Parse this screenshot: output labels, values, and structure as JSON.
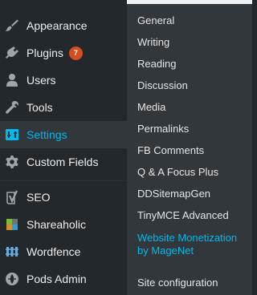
{
  "menu": {
    "items": [
      {
        "label": "Appearance",
        "icon": "paintbrush-icon"
      },
      {
        "label": "Plugins",
        "icon": "plugin-icon",
        "badge": "7"
      },
      {
        "label": "Users",
        "icon": "users-icon"
      },
      {
        "label": "Tools",
        "icon": "wrench-icon"
      },
      {
        "label": "Settings",
        "icon": "settings-icon",
        "active": true
      },
      {
        "label": "Custom Fields",
        "icon": "gear-icon"
      },
      {
        "label": "SEO",
        "icon": "seo-icon"
      },
      {
        "label": "Shareaholic",
        "icon": "shareaholic-icon"
      },
      {
        "label": "Wordfence",
        "icon": "wordfence-icon"
      },
      {
        "label": "Pods Admin",
        "icon": "pods-icon"
      }
    ]
  },
  "submenu": {
    "items": [
      "General",
      "Writing",
      "Reading",
      "Discussion",
      "Media",
      "Permalinks",
      "FB Comments",
      "Q & A Focus Plus",
      "DDSitemapGen",
      "TinyMCE Advanced",
      "Website Monetization by MageNet",
      "Site configuration"
    ],
    "highlighted_index": 10
  },
  "colors": {
    "menu_bg": "#23282d",
    "submenu_bg": "#32373c",
    "accent": "#00b9eb",
    "badge": "#d54e21"
  }
}
